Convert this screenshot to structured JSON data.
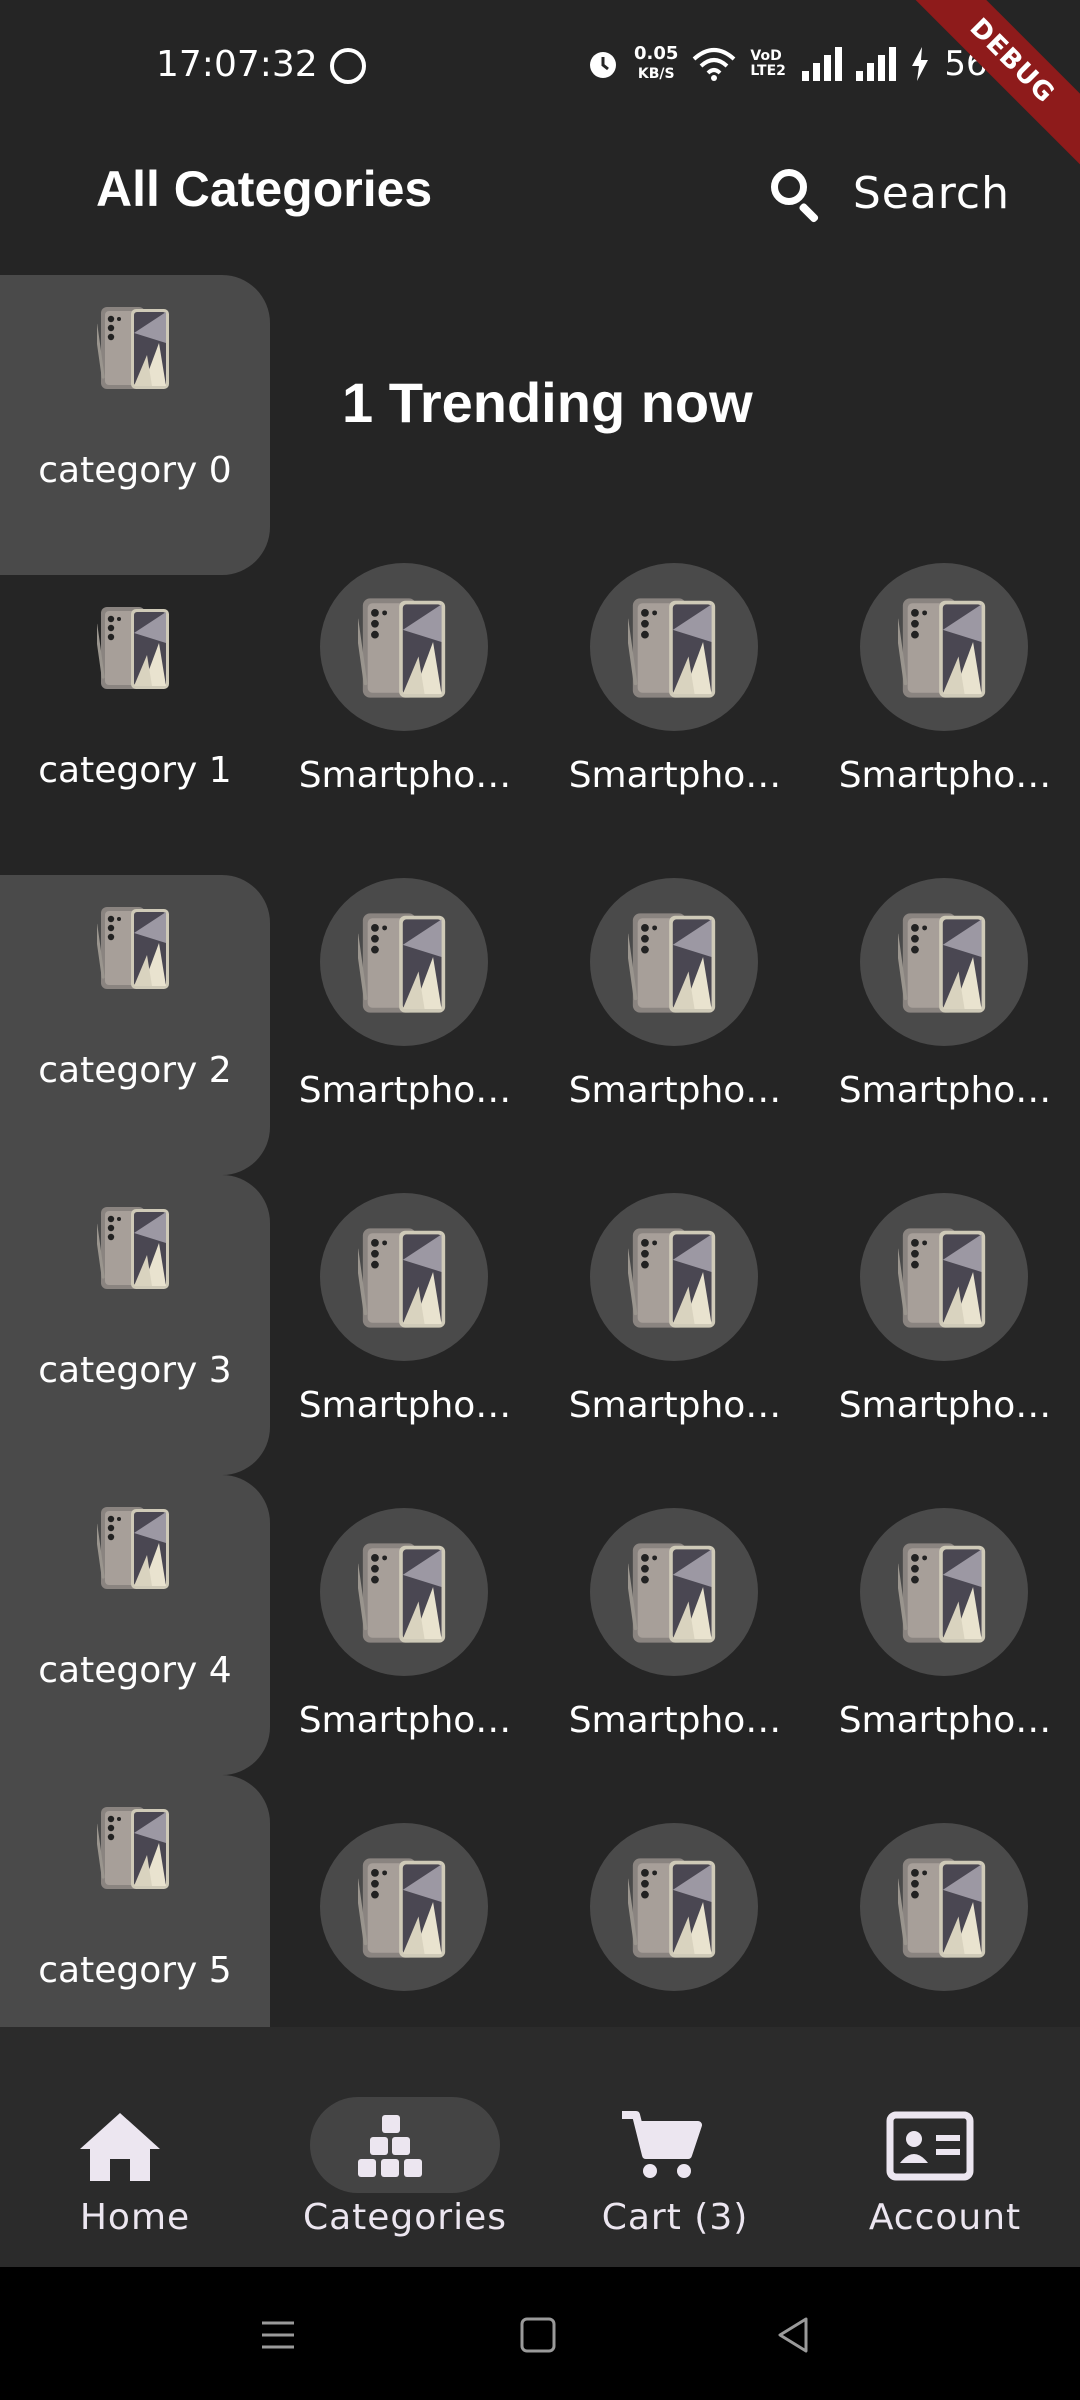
{
  "status_bar": {
    "time": "17:07:32",
    "net_speed_value": "0.05",
    "net_speed_unit": "KB/S",
    "volte": "VoD LTE2",
    "battery": "56%",
    "debug_banner": "DEBUG",
    "icons": [
      "whatsapp-icon",
      "alarm-icon",
      "wifi-icon",
      "signal-icon",
      "charging-icon"
    ]
  },
  "app_bar": {
    "title": "All Categories",
    "search_label": "Search",
    "search_icon": "search-icon"
  },
  "sidebar": {
    "selected_index": 1,
    "items": [
      {
        "label": "category 0"
      },
      {
        "label": "category 1"
      },
      {
        "label": "category 2"
      },
      {
        "label": "category 3"
      },
      {
        "label": "category 4"
      },
      {
        "label": "category 5"
      }
    ]
  },
  "content": {
    "section_title": "1 Trending now",
    "rows": [
      [
        "Smartpho…",
        "Smartpho…",
        "Smartpho…"
      ],
      [
        "Smartpho…",
        "Smartpho…",
        "Smartpho…"
      ],
      [
        "Smartpho…",
        "Smartpho…",
        "Smartpho…"
      ],
      [
        "Smartpho…",
        "Smartpho…",
        "Smartpho…"
      ],
      [
        "",
        "",
        ""
      ]
    ]
  },
  "bottom_nav": {
    "selected": "Categories",
    "items": [
      {
        "label": "Home",
        "icon": "home-icon"
      },
      {
        "label": "Categories",
        "icon": "categories-icon"
      },
      {
        "label": "Cart (3)",
        "icon": "cart-icon"
      },
      {
        "label": "Account",
        "icon": "account-card-icon"
      }
    ]
  },
  "system_nav": {
    "icons": [
      "menu-icon",
      "home-square-icon",
      "back-triangle-icon"
    ]
  },
  "colors": {
    "background": "#252525",
    "tile": "#4a4a4a",
    "nav_bar": "#2b2b2b",
    "nav_pill": "#444444",
    "debug_ribbon": "#8e1b1b"
  }
}
